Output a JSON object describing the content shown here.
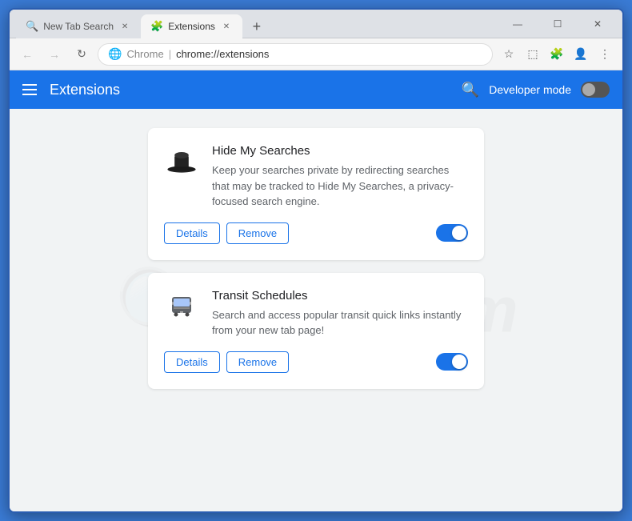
{
  "browser": {
    "tabs": [
      {
        "id": "tab1",
        "label": "New Tab Search",
        "icon": "search",
        "active": false
      },
      {
        "id": "tab2",
        "label": "Extensions",
        "icon": "puzzle",
        "active": true
      }
    ],
    "address": {
      "protocol": "Chrome",
      "separator": "|",
      "url": "chrome://extensions"
    },
    "window_controls": {
      "minimize": "—",
      "maximize": "☐",
      "close": "✕"
    }
  },
  "extensions_page": {
    "title": "Extensions",
    "developer_mode_label": "Developer mode",
    "developer_mode_on": false,
    "extensions": [
      {
        "id": "ext1",
        "name": "Hide My Searches",
        "description": "Keep your searches private by redirecting searches that may be tracked to Hide My Searches, a privacy-focused search engine.",
        "enabled": true,
        "details_label": "Details",
        "remove_label": "Remove"
      },
      {
        "id": "ext2",
        "name": "Transit Schedules",
        "description": "Search and access popular transit quick links instantly from your new tab page!",
        "enabled": true,
        "details_label": "Details",
        "remove_label": "Remove"
      }
    ]
  }
}
